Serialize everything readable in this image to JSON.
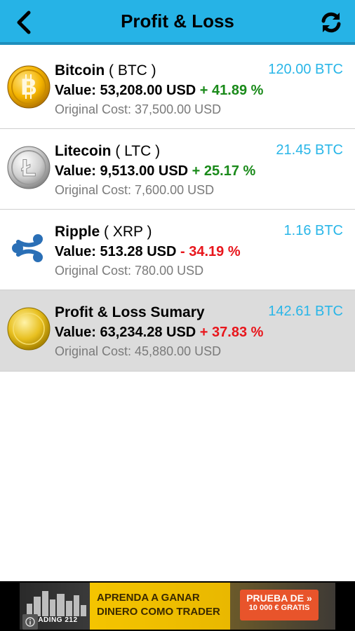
{
  "header": {
    "title": "Profit & Loss",
    "back_icon": "chevron-left-icon",
    "refresh_icon": "refresh-icon",
    "bg_color": "#26b3e6"
  },
  "coins": [
    {
      "name": "Bitcoin",
      "symbol": "( BTC )",
      "btc_amount": "120.00 BTC",
      "value": "Value: 53,208.00 USD",
      "change": "+ 41.89 %",
      "change_dir": "positive",
      "original_cost": "Original Cost: 37,500.00 USD",
      "icon": "bitcoin-icon"
    },
    {
      "name": "Litecoin",
      "symbol": "( LTC )",
      "btc_amount": "21.45 BTC",
      "value": "Value: 9,513.00 USD",
      "change": "+ 25.17 %",
      "change_dir": "positive",
      "original_cost": "Original Cost: 7,600.00 USD",
      "icon": "litecoin-icon"
    },
    {
      "name": "Ripple",
      "symbol": "( XRP )",
      "btc_amount": "1.16 BTC",
      "value": "Value: 513.28 USD",
      "change": "- 34.19 %",
      "change_dir": "negative",
      "original_cost": "Original Cost: 780.00 USD",
      "icon": "ripple-icon"
    }
  ],
  "summary": {
    "name": "Profit & Loss Sumary",
    "btc_amount": "142.61 BTC",
    "value": "Value: 63,234.28 USD",
    "change": "+ 37.83 %",
    "change_dir": "positive",
    "original_cost": "Original Cost: 45,880.00 USD",
    "icon": "gold-coin-icon"
  },
  "colors": {
    "positive": "#1a8a1a",
    "negative": "#e8161c",
    "btc_amount": "#29b6e8",
    "summary_bg": "#dcdcdc"
  },
  "ad": {
    "brand": "TRADING 212",
    "headline_1": "APRENDA A GANAR",
    "headline_2": "DINERO COMO TRADER",
    "cta_1": "PRUEBA DE »",
    "cta_2": "10 000 € GRATIS",
    "info_icon": "info-icon"
  }
}
